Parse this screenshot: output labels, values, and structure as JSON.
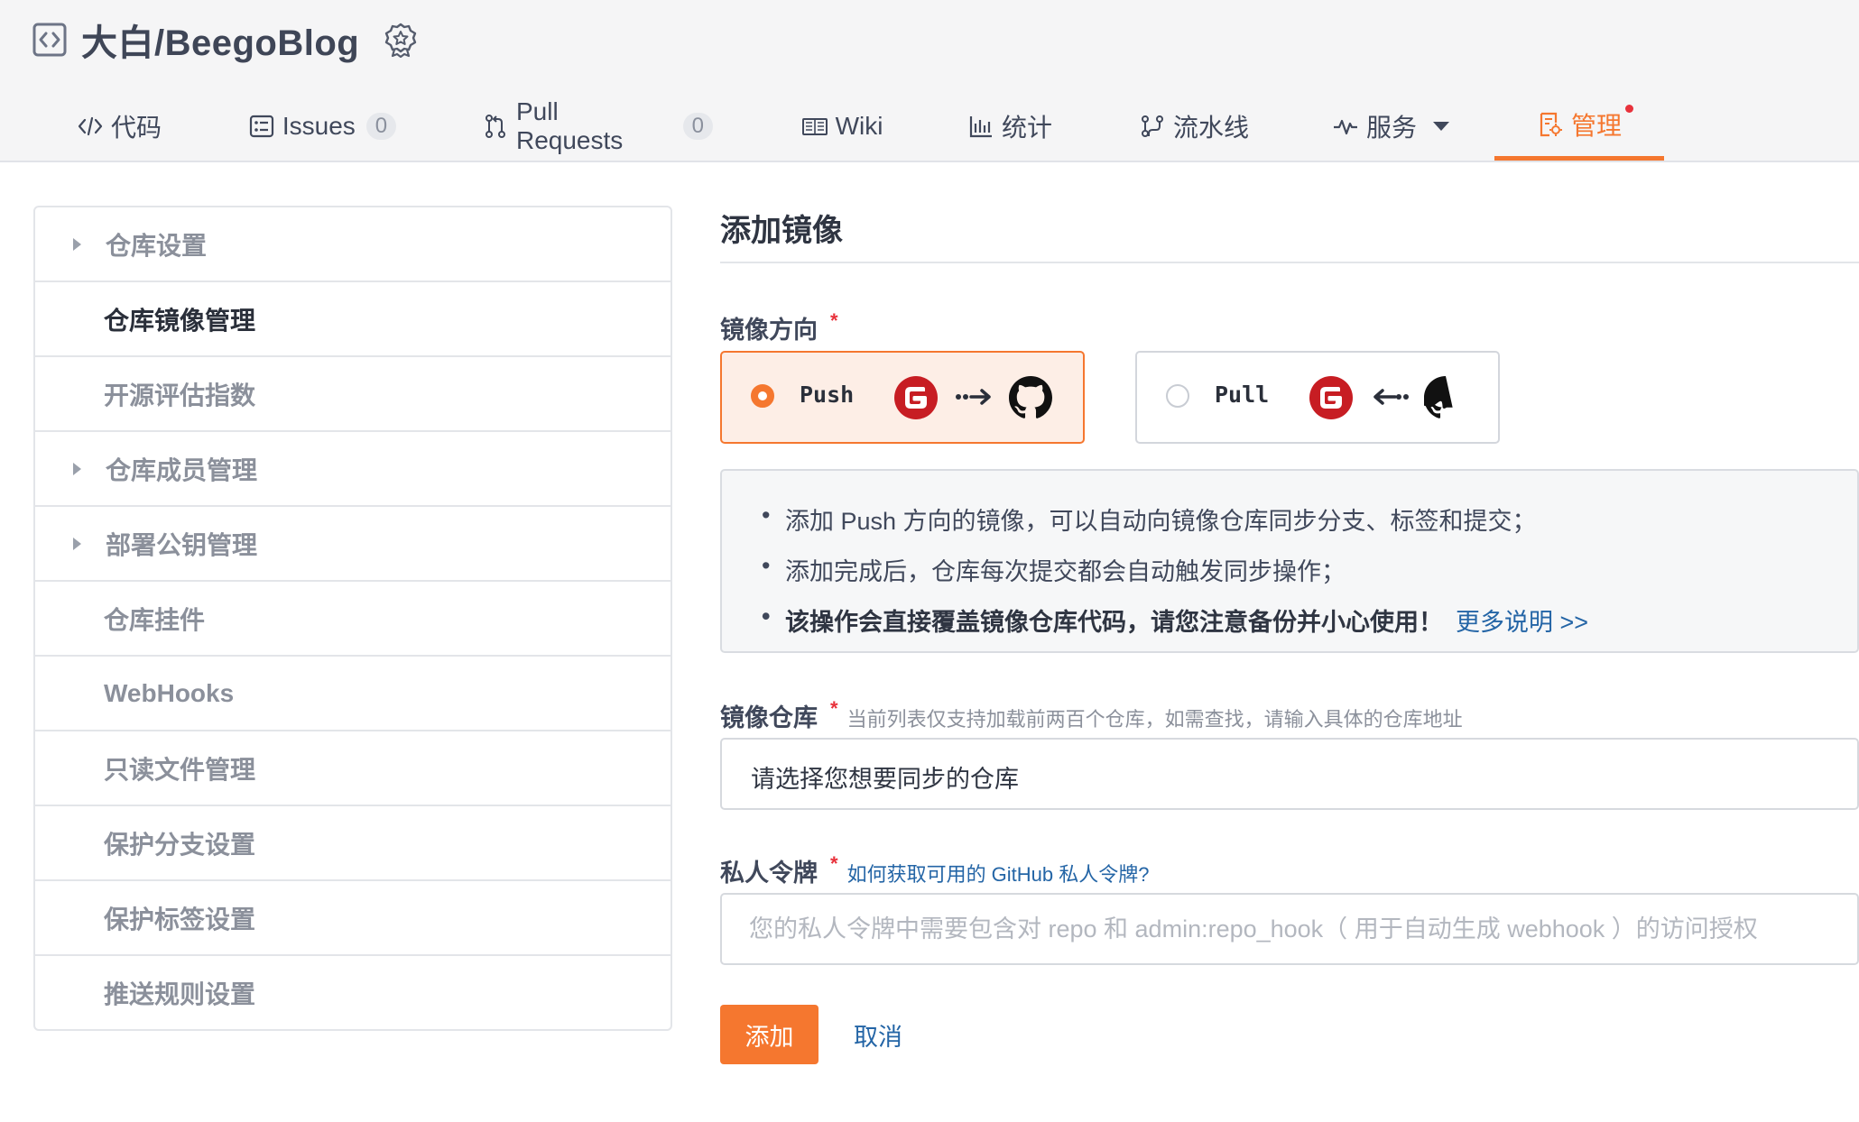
{
  "header": {
    "repo_title": "大白/BeegoBlog",
    "repo_icon": "code-repo-icon",
    "badge_icon": "award-badge-icon"
  },
  "tabs": [
    {
      "label": "代码",
      "icon": "code-icon"
    },
    {
      "label": "Issues",
      "icon": "issues-icon",
      "count": "0"
    },
    {
      "label": "Pull Requests",
      "icon": "pull-request-icon",
      "count": "0"
    },
    {
      "label": "Wiki",
      "icon": "wiki-icon"
    },
    {
      "label": "统计",
      "icon": "stats-icon"
    },
    {
      "label": "流水线",
      "icon": "pipeline-icon"
    },
    {
      "label": "服务",
      "icon": "pulse-icon"
    },
    {
      "label": "管理",
      "icon": "manage-icon",
      "active": true
    }
  ],
  "sidebar": {
    "items": [
      {
        "label": "仓库设置",
        "caret": true
      },
      {
        "label": "仓库镜像管理",
        "active": true
      },
      {
        "label": "开源评估指数"
      },
      {
        "label": "仓库成员管理",
        "caret": true
      },
      {
        "label": "部署公钥管理",
        "caret": true
      },
      {
        "label": "仓库挂件"
      },
      {
        "label": "WebHooks"
      },
      {
        "label": "只读文件管理"
      },
      {
        "label": "保护分支设置"
      },
      {
        "label": "保护标签设置"
      },
      {
        "label": "推送规则设置"
      }
    ]
  },
  "main": {
    "title": "添加镜像",
    "direction_label": "镜像方向",
    "required_mark": "*",
    "push_label": "Push",
    "pull_label": "Pull",
    "info": {
      "line1": "添加 Push 方向的镜像，可以自动向镜像仓库同步分支、标签和提交；",
      "line2": "添加完成后，仓库每次提交都会自动触发同步操作；",
      "line3": "该操作会直接覆盖镜像仓库代码，请您注意备份并小心使用！",
      "more_link": "更多说明 >>"
    },
    "mirror_repo_label": "镜像仓库",
    "mirror_repo_hint": "当前列表仅支持加载前两百个仓库，如需查找，请输入具体的仓库地址",
    "mirror_repo_select": "请选择您想要同步的仓库",
    "token_label": "私人令牌",
    "token_help_link": "如何获取可用的 GitHub 私人令牌?",
    "token_placeholder": "您的私人令牌中需要包含对 repo 和 admin:repo_hook（ 用于自动生成 webhook ）的访问授权",
    "add_button": "添加",
    "cancel_button": "取消"
  },
  "colors": {
    "accent": "#f5772f",
    "link": "#2465a6",
    "required": "#e8323c",
    "gitee": "#c71d23"
  }
}
